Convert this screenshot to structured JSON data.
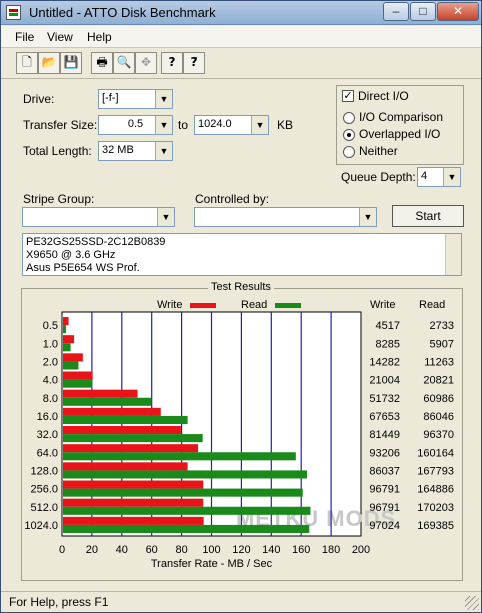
{
  "window": {
    "title": "Untitled - ATTO Disk Benchmark"
  },
  "titlebar": {
    "minimize": "–",
    "maximize": "□",
    "close": "✕"
  },
  "menu": {
    "file": "File",
    "view": "View",
    "help": "Help"
  },
  "toolbar": {
    "icons": [
      "new-file-icon",
      "open-folder-icon",
      "save-icon",
      "print-icon",
      "print-preview-icon",
      "move-icon",
      "help-icon",
      "context-help-icon"
    ],
    "new": "🗋",
    "open": "📂",
    "save": "💾",
    "print": "🖶",
    "preview": "🔍",
    "move": "✥",
    "help": "?",
    "context_help": "?⃗"
  },
  "form": {
    "drive_label": "Drive:",
    "drive_value": "[-f-]",
    "transfer_size_label": "Transfer Size:",
    "transfer_from": "0.5",
    "to_label": "to",
    "transfer_to": "1024.0",
    "kb_label": "KB",
    "total_length_label": "Total Length:",
    "total_length_value": "32 MB",
    "stripe_group_label": "Stripe Group:",
    "stripe_group_value": "",
    "controlled_by_label": "Controlled by:",
    "controlled_by_value": "",
    "start_label": "Start"
  },
  "options": {
    "direct_io_label": "Direct I/O",
    "direct_io_checked": true,
    "io_comparison_label": "I/O Comparison",
    "overlapped_io_label": "Overlapped I/O",
    "neither_label": "Neither",
    "selected": "Overlapped I/O",
    "queue_depth_label": "Queue Depth:",
    "queue_depth_value": "4"
  },
  "description": {
    "lines": [
      "PE32GS25SSD-2C12B0839",
      "X9650 @ 3.6 GHz",
      "Asus P5E654 WS Prof."
    ]
  },
  "chart_data": {
    "type": "bar",
    "title": "Test Results",
    "xlabel": "Transfer Rate - MB / Sec",
    "xlim": [
      0,
      200
    ],
    "xticks": [
      "0",
      "20",
      "40",
      "60",
      "80",
      "100",
      "120",
      "140",
      "160",
      "180",
      "200"
    ],
    "categories": [
      "0.5",
      "1.0",
      "2.0",
      "4.0",
      "8.0",
      "16.0",
      "32.0",
      "64.0",
      "128.0",
      "256.0",
      "512.0",
      "1024.0"
    ],
    "series": [
      {
        "name": "Write",
        "color": "#e8141a",
        "values": [
          4517,
          8285,
          14282,
          21004,
          51732,
          67653,
          81449,
          93206,
          86037,
          96791,
          96791,
          97024
        ]
      },
      {
        "name": "Read",
        "color": "#1a8a1a",
        "values": [
          2733,
          5907,
          11263,
          20821,
          60986,
          86046,
          96370,
          160164,
          167793,
          164886,
          170203,
          169385
        ]
      }
    ],
    "value_headers": [
      "Write",
      "Read"
    ],
    "watermark": "METKU MODS"
  },
  "statusbar": {
    "text": "For Help, press F1"
  }
}
